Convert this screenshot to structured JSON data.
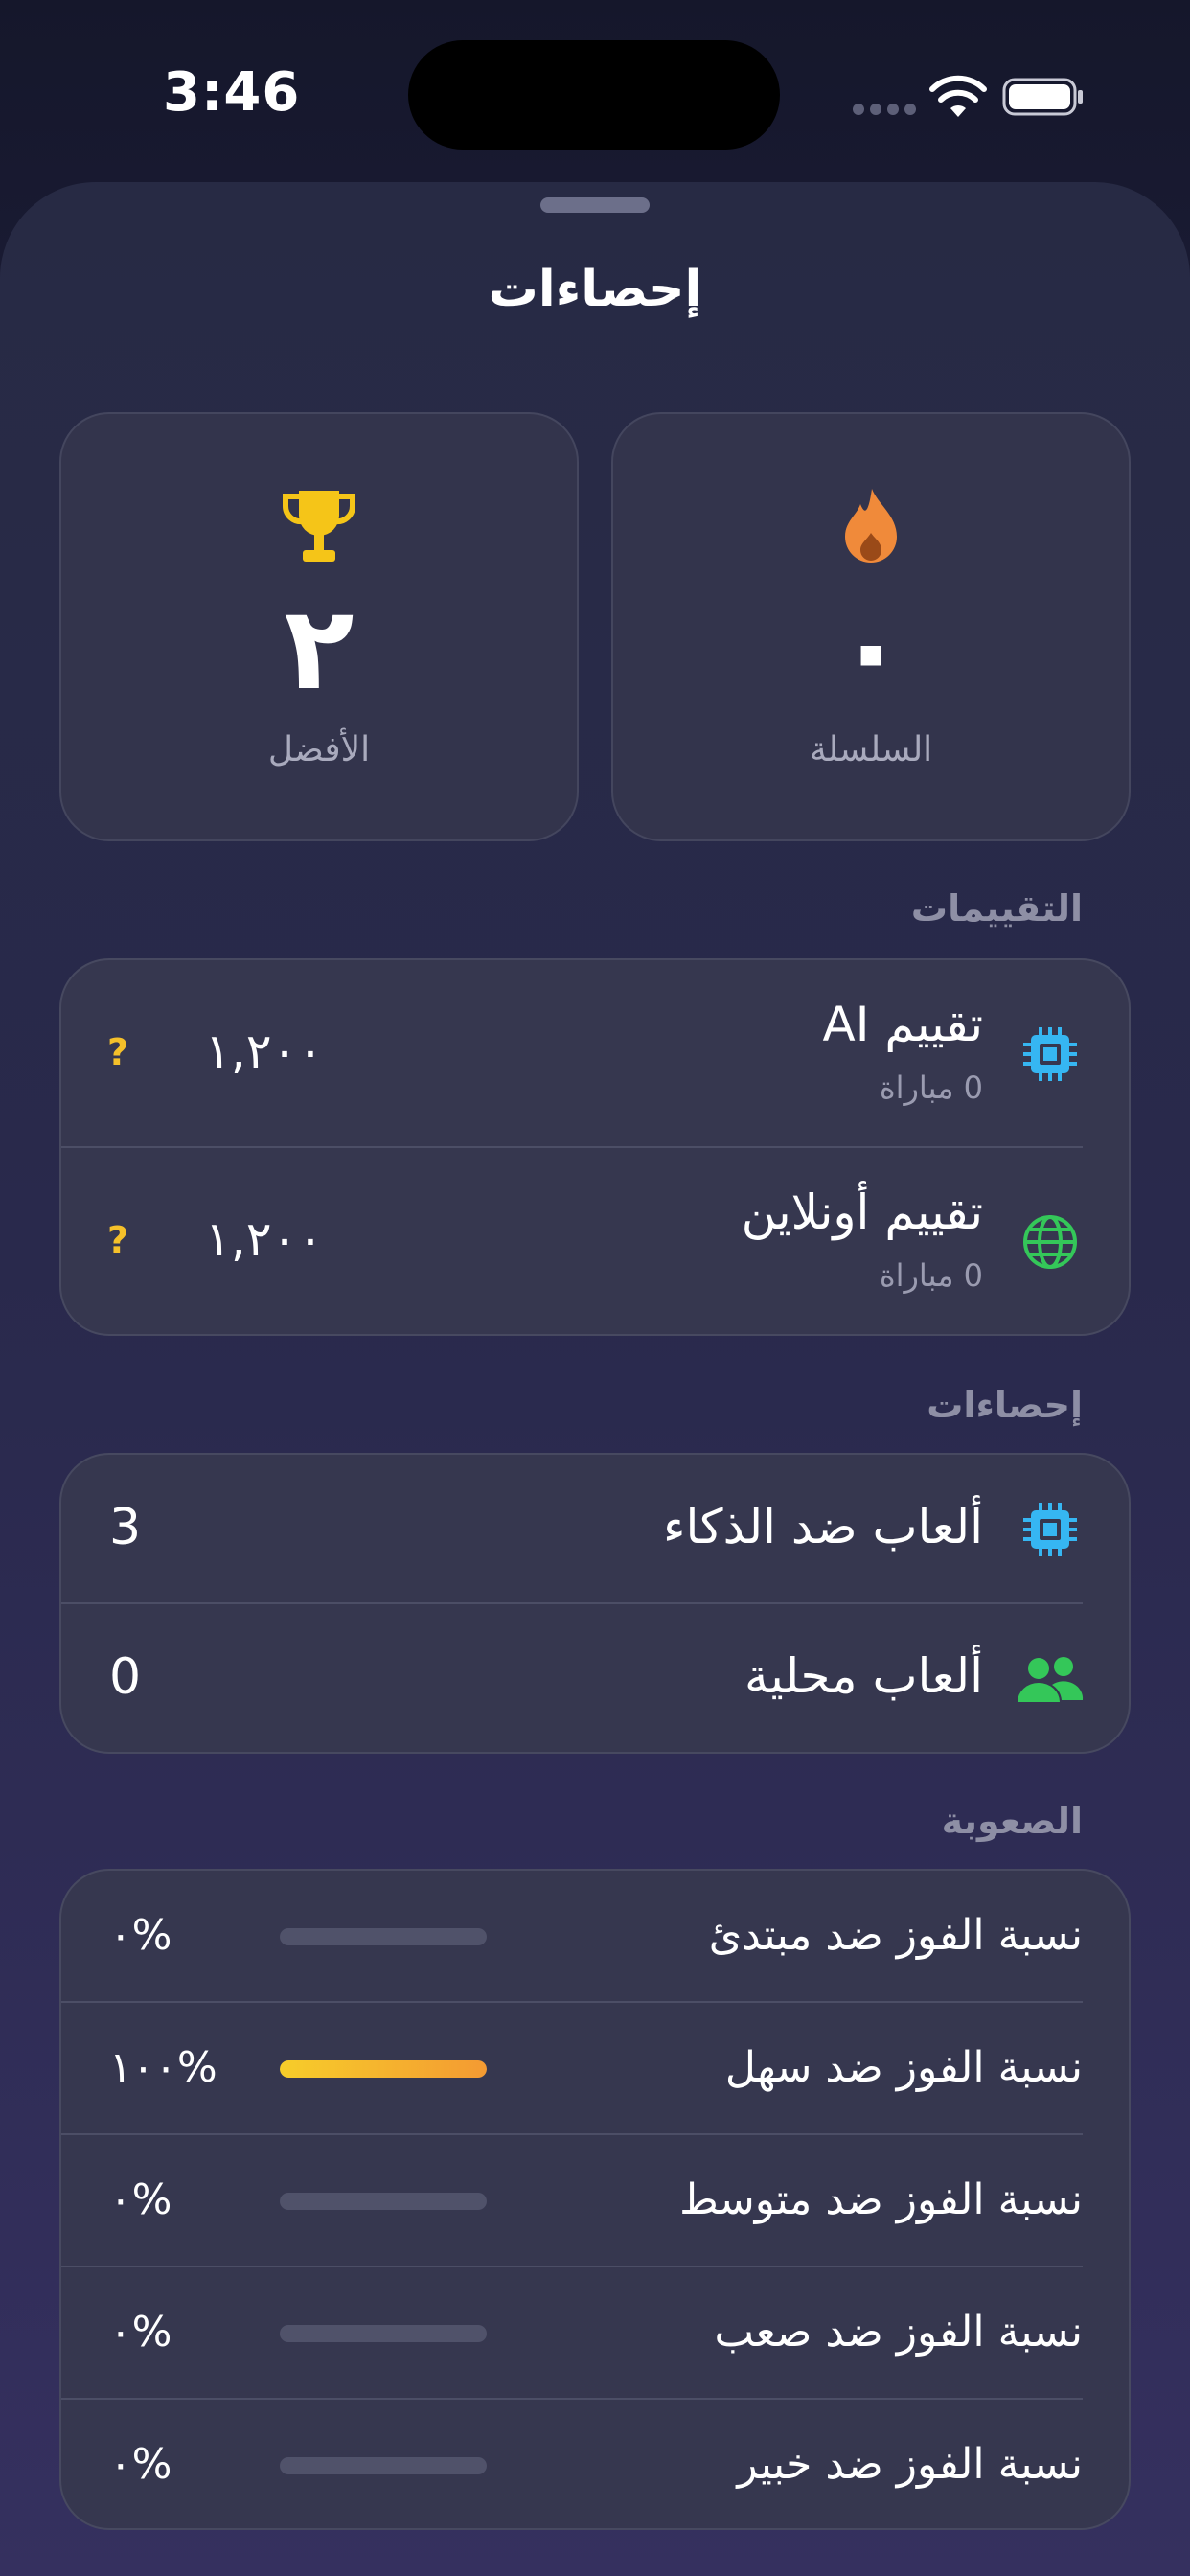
{
  "status_bar": {
    "time": "3:46"
  },
  "sheet": {
    "title": "إحصاءات"
  },
  "stats": [
    {
      "id": "best",
      "label": "الأفضل",
      "value": "٢",
      "icon": "trophy-icon",
      "color": "#f5c518"
    },
    {
      "id": "streak",
      "label": "السلسلة",
      "value": "٠",
      "icon": "flame-icon",
      "color": "#f08a3a"
    }
  ],
  "ratings": {
    "header": "التقييمات",
    "items": [
      {
        "title": "تقييم AI",
        "subtitle": "0 مباراة",
        "value": "١,٢٠٠",
        "badge": "?",
        "icon": "cpu-icon",
        "color": "#36b6f2"
      },
      {
        "title": "تقييم أونلاين",
        "subtitle": "0 مباراة",
        "value": "١,٢٠٠",
        "badge": "?",
        "icon": "globe-icon",
        "color": "#34c759"
      }
    ]
  },
  "statistics": {
    "header": "إحصاءات",
    "items": [
      {
        "title": "ألعاب ضد الذكاء",
        "value": "3",
        "icon": "cpu-icon",
        "color": "#36b6f2"
      },
      {
        "title": "ألعاب محلية",
        "value": "0",
        "icon": "people-icon",
        "color": "#34c759"
      }
    ]
  },
  "difficulty": {
    "header": "الصعوبة",
    "items": [
      {
        "label": "نسبة الفوز ضد مبتدئ",
        "percent_text": "٠%",
        "progress": 0
      },
      {
        "label": "نسبة الفوز ضد سهل",
        "percent_text": "١٠٠%",
        "progress": 1
      },
      {
        "label": "نسبة الفوز ضد متوسط",
        "percent_text": "٠%",
        "progress": 0
      },
      {
        "label": "نسبة الفوز ضد صعب",
        "percent_text": "٠%",
        "progress": 0
      },
      {
        "label": "نسبة الفوز ضد خبير",
        "percent_text": "٠%",
        "progress": 0
      }
    ]
  }
}
